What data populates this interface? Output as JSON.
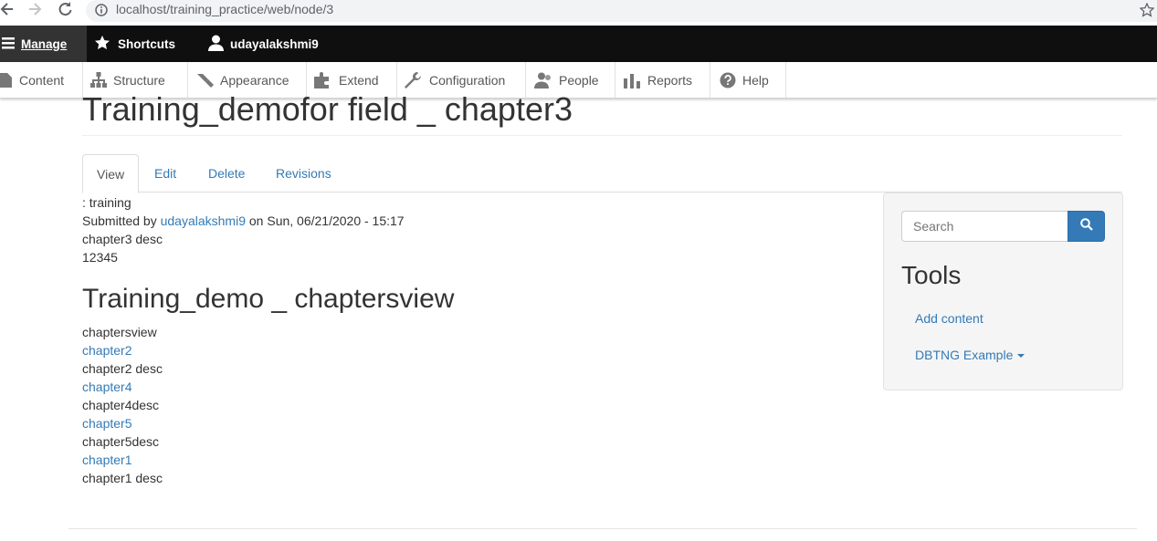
{
  "browser": {
    "url": "localhost/training_practice/web/node/3"
  },
  "toolbar": {
    "manage_label": "Manage",
    "shortcuts_label": "Shortcuts",
    "user_label": "udayalakshmi9"
  },
  "tray": {
    "items": [
      {
        "label": "Content",
        "icon": "content-icon"
      },
      {
        "label": "Structure",
        "icon": "structure-icon"
      },
      {
        "label": "Appearance",
        "icon": "appearance-icon"
      },
      {
        "label": "Extend",
        "icon": "extend-icon"
      },
      {
        "label": "Configuration",
        "icon": "configuration-icon"
      },
      {
        "label": "People",
        "icon": "people-icon"
      },
      {
        "label": "Reports",
        "icon": "reports-icon"
      },
      {
        "label": "Help",
        "icon": "help-icon"
      }
    ]
  },
  "page": {
    "title": "Training_demofor field _ chapter3"
  },
  "tabs": [
    {
      "label": "View",
      "active": true
    },
    {
      "label": "Edit"
    },
    {
      "label": "Delete"
    },
    {
      "label": "Revisions"
    }
  ],
  "node": {
    "field_line": ": training",
    "submitted_prefix": "Submitted by",
    "author": "udayalakshmi9",
    "submitted_suffix": "on Sun, 06/21/2020 - 15:17",
    "description": "chapter3 desc",
    "number": "12345"
  },
  "view": {
    "title": "Training_demo _ chaptersview",
    "header": "chaptersview",
    "rows": [
      {
        "title": "chapter2",
        "desc": "chapter2 desc"
      },
      {
        "title": "chapter4",
        "desc": "chapter4desc"
      },
      {
        "title": "chapter5",
        "desc": "chapter5desc"
      },
      {
        "title": "chapter1",
        "desc": "chapter1 desc"
      }
    ]
  },
  "sidebar": {
    "search_placeholder": "Search",
    "tools_title": "Tools",
    "links": [
      {
        "label": "Add content"
      },
      {
        "label": "DBTNG Example",
        "has_caret": true
      }
    ]
  },
  "colors": {
    "link": "#337ab7",
    "toolbar_bg": "#0f0f0f",
    "manage_bg": "#333333"
  }
}
